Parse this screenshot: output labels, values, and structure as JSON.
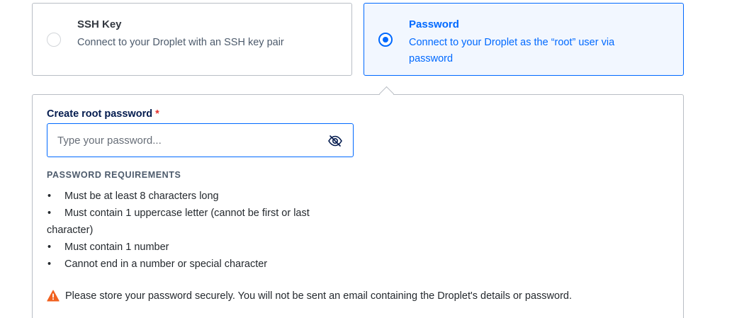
{
  "auth_options": {
    "ssh": {
      "title": "SSH Key",
      "description": "Connect to your Droplet with an SSH key pair",
      "selected": false
    },
    "password": {
      "title": "Password",
      "description": "Connect to your Droplet as the “root” user via password",
      "selected": true
    }
  },
  "password_panel": {
    "label": "Create root password",
    "required_marker": "*",
    "input": {
      "value": "",
      "placeholder": "Type your password..."
    },
    "toggle_icon": "eye-slash-icon",
    "requirements_heading": "PASSWORD REQUIREMENTS",
    "requirements": [
      "Must be at least 8 characters long",
      "Must contain 1 uppercase letter (cannot be first or last character)",
      "Must contain 1 number",
      "Cannot end in a number or special character"
    ],
    "warning": {
      "icon": "warning-triangle-icon",
      "text": "Please store your password securely. You will not be sent an email containing the Droplet's details or password."
    }
  },
  "colors": {
    "accent": "#0069ff",
    "selected_bg": "#f2f7ff",
    "border": "#b9bec5",
    "required": "#e5322d",
    "warning": "#f1611f"
  }
}
